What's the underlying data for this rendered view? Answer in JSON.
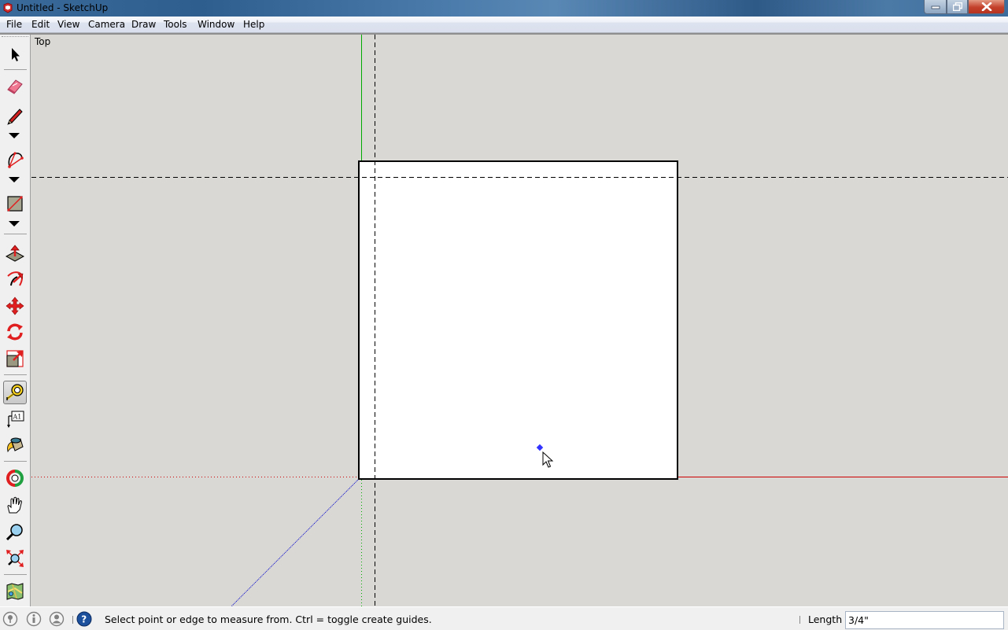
{
  "window": {
    "title": "Untitled - SketchUp",
    "controls": {
      "minimize": "minimize",
      "restore": "restore",
      "close": "close"
    }
  },
  "menubar": {
    "items": [
      "File",
      "Edit",
      "View",
      "Camera",
      "Draw",
      "Tools",
      "Window",
      "Help"
    ]
  },
  "toolbar": {
    "tools": [
      {
        "name": "select",
        "icon": "arrow-cursor-icon"
      },
      {
        "name": "eraser",
        "icon": "eraser-icon"
      },
      {
        "name": "line",
        "icon": "pencil-icon",
        "has_dropdown": true
      },
      {
        "name": "arc",
        "icon": "arc-icon",
        "has_dropdown": true
      },
      {
        "name": "rectangle",
        "icon": "rectangle-icon",
        "has_dropdown": true
      },
      {
        "name": "push-pull",
        "icon": "push-pull-icon"
      },
      {
        "name": "follow-me",
        "icon": "follow-me-icon"
      },
      {
        "name": "move",
        "icon": "move-icon"
      },
      {
        "name": "rotate",
        "icon": "rotate-icon"
      },
      {
        "name": "scale",
        "icon": "scale-icon"
      },
      {
        "name": "tape-measure",
        "icon": "tape-measure-icon",
        "active": true
      },
      {
        "name": "text",
        "icon": "text-label-icon",
        "label": "A1"
      },
      {
        "name": "paint-bucket",
        "icon": "paint-bucket-icon"
      },
      {
        "name": "orbit",
        "icon": "orbit-icon"
      },
      {
        "name": "pan",
        "icon": "hand-icon"
      },
      {
        "name": "zoom",
        "icon": "magnifier-icon"
      },
      {
        "name": "zoom-extents",
        "icon": "zoom-extents-icon"
      },
      {
        "name": "add-location",
        "icon": "map-icon"
      }
    ]
  },
  "viewport": {
    "view_name": "Top",
    "colors": {
      "background": "#d9d8d4",
      "face": "#ffffff",
      "edge": "#000000",
      "red_axis": "#cc0000",
      "green_axis": "#00aa00",
      "blue_axis": "#0000cc",
      "inference_point": "#3333ff"
    }
  },
  "statusbar": {
    "icons": [
      "geo-location-icon",
      "credits-icon",
      "account-icon",
      "help-icon"
    ],
    "message": "Select point or edge to measure from.  Ctrl = toggle create guides.",
    "measurement_label": "Length",
    "measurement_value": "3/4\""
  }
}
